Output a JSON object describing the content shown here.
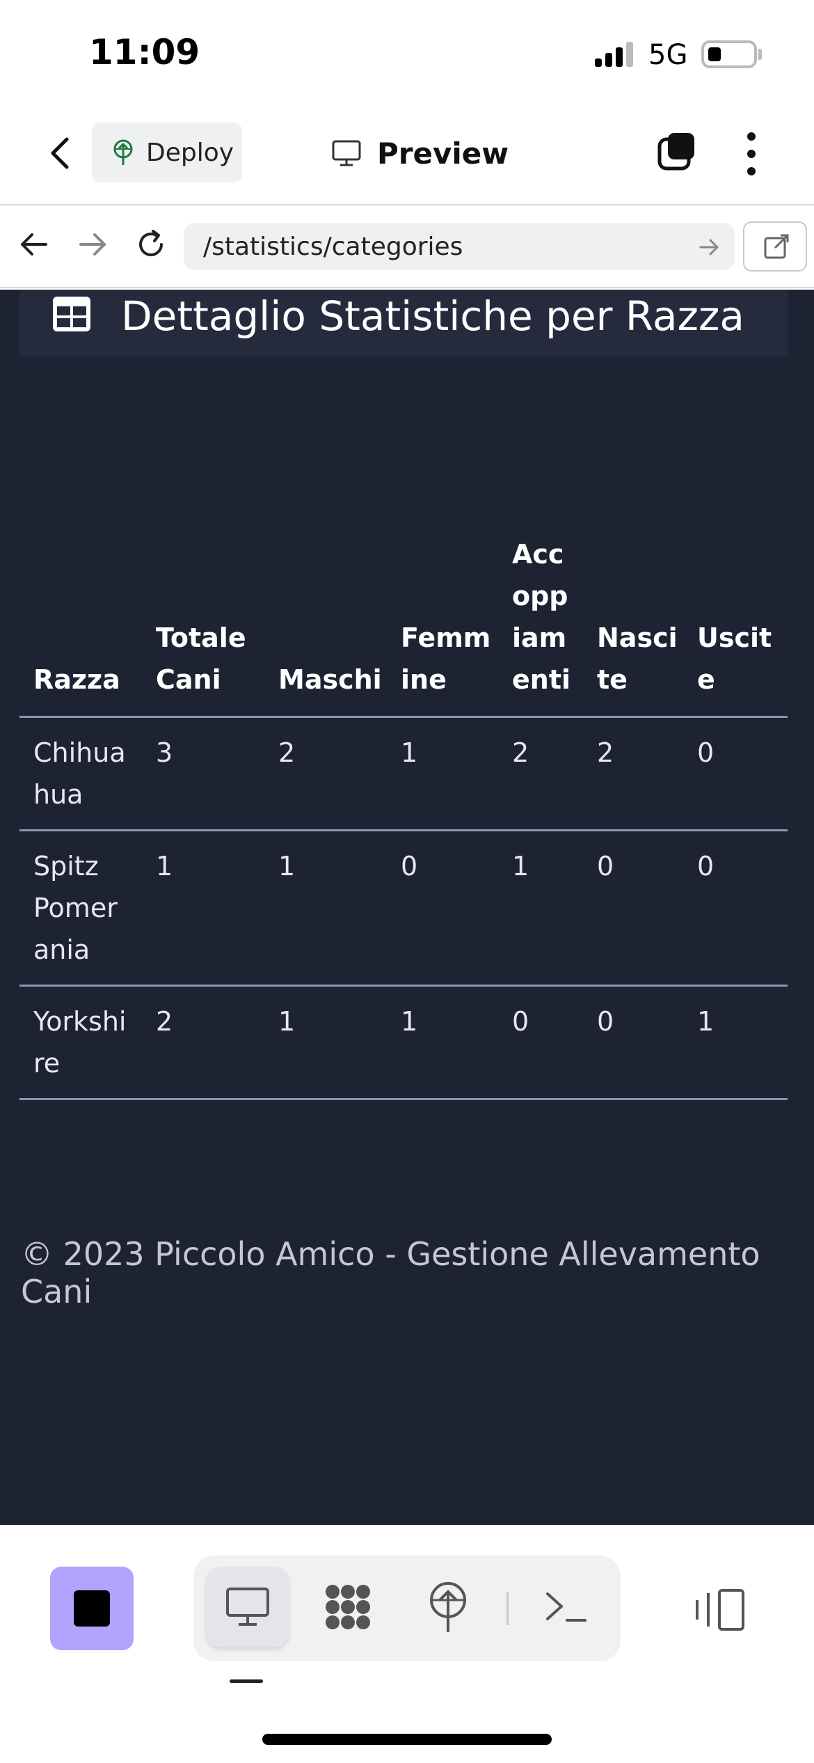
{
  "status_bar": {
    "time": "11:09",
    "network": "5G"
  },
  "toolbar": {
    "deploy_label": "Deploy",
    "preview_label": "Preview"
  },
  "url_bar": {
    "path": "/statistics/categories"
  },
  "card": {
    "title": "Dettaglio Statistiche per Razza"
  },
  "table": {
    "headers": [
      "Razza",
      "Totale Cani",
      "Maschi",
      "Femmine",
      "Accoppiamenti",
      "Nascite",
      "Uscite"
    ],
    "rows": [
      [
        "Chihuahua",
        "3",
        "2",
        "1",
        "2",
        "2",
        "0"
      ],
      [
        "Spitz Pomerania",
        "1",
        "1",
        "0",
        "1",
        "0",
        "0"
      ],
      [
        "Yorkshire",
        "2",
        "1",
        "1",
        "0",
        "0",
        "1"
      ]
    ]
  },
  "footer": {
    "text": "© 2023 Piccolo Amico - Gestione Allevamento Cani"
  },
  "colors": {
    "content_bg": "#1e2334",
    "card_header_bg": "#252b3d",
    "stop_button": "#b3a3ff"
  }
}
